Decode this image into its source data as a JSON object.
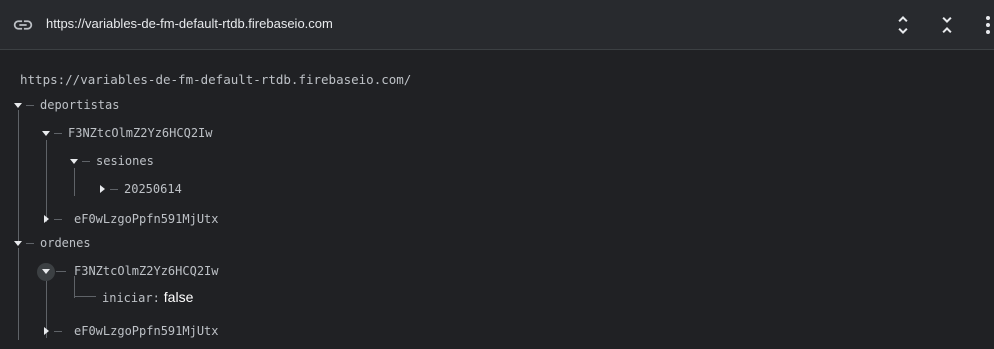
{
  "header": {
    "url": "https://variables-de-fm-default-rtdb.firebaseio.com",
    "icons": [
      "link-icon",
      "expand-all-icon",
      "collapse-all-icon",
      "more-vert-icon"
    ]
  },
  "tree": {
    "root_url": "https://variables-de-fm-default-rtdb.firebaseio.com/",
    "deportistas": "deportistas",
    "deportistas_child1": "F3NZtcOlmZ2Yz6HCQ2Iw",
    "sesiones": "sesiones",
    "sesion_date": "20250614",
    "deportistas_child2": "eF0wLzgoPpfn591MjUtx",
    "ordenes": "ordenes",
    "ordenes_child1": "F3NZtcOlmZ2Yz6HCQ2Iw",
    "iniciar_key": "iniciar:",
    "iniciar_value": "false",
    "ordenes_child2": "eF0wLzgoPpfn591MjUtx"
  },
  "colors": {
    "background": "#202124",
    "topbar": "#282a2e",
    "text": "#bdc1c6",
    "value": "#ffffff",
    "line": "#5f6368"
  }
}
